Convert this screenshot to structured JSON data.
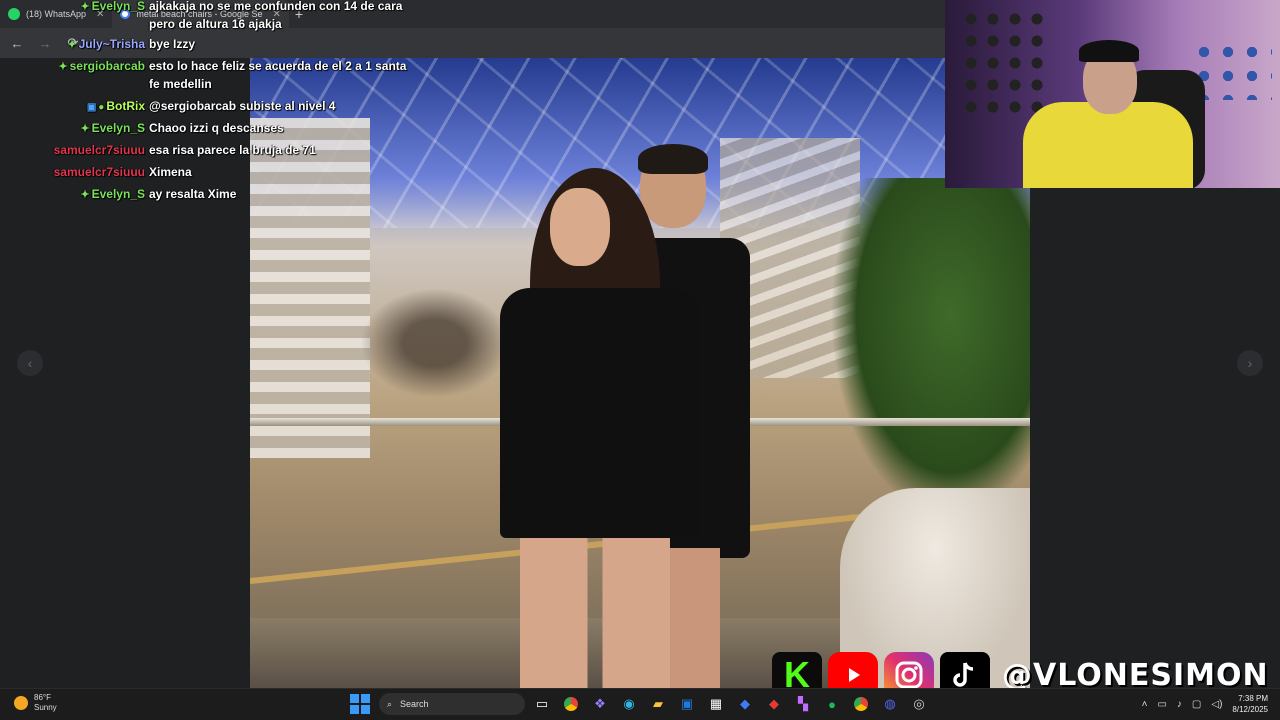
{
  "browser": {
    "tabs": [
      {
        "label": "(18) WhatsApp",
        "icon": "whatsapp-icon"
      },
      {
        "label": "metal beach chairs - Google Se",
        "icon": "google-icon"
      }
    ],
    "new_tab": "+",
    "nav": {
      "back": "←",
      "forward": "→",
      "reload": "⟳"
    }
  },
  "viewer": {
    "prev": "‹",
    "next": "›"
  },
  "chat": [
    {
      "user": "Evelyn_S",
      "text": "ajkakaja no se me confunden con 14 de cara pero de altura 16 ajakja",
      "color": "#7be05a",
      "badge": "diamond"
    },
    {
      "user": "July~Trisha",
      "text": "bye Izzy",
      "color": "#9aa8ff",
      "badge": "diamond"
    },
    {
      "user": "sergiobarcab",
      "text": "esto lo hace feliz se acuerda de el 2 a 1 santa fe medellin",
      "color": "#7be05a",
      "badge": "diamond"
    },
    {
      "user": "BotRix",
      "text": "@sergiobarcab subiste al nivel 4",
      "color": "#b8ff5a",
      "badge": "bot"
    },
    {
      "user": "Evelyn_S",
      "text": "Chaoo izzi q descanses",
      "color": "#7be05a",
      "badge": "diamond"
    },
    {
      "user": "samuelcr7siuuu",
      "text": "esa risa parece la bruja de 71",
      "color": "#e0364e",
      "badge": ""
    },
    {
      "user": "samuelcr7siuuu",
      "text": "Ximena",
      "color": "#e0364e",
      "badge": ""
    },
    {
      "user": "Evelyn_S",
      "text": "ay resalta Xime",
      "color": "#7be05a",
      "badge": "diamond"
    }
  ],
  "socials": {
    "kick_letter": "K",
    "handle": "@VLONESIMON"
  },
  "taskbar": {
    "weather_temp": "86°F",
    "weather_desc": "Sunny",
    "search_label": "Search",
    "time": "7:38 PM",
    "date": "8/12/2025"
  }
}
